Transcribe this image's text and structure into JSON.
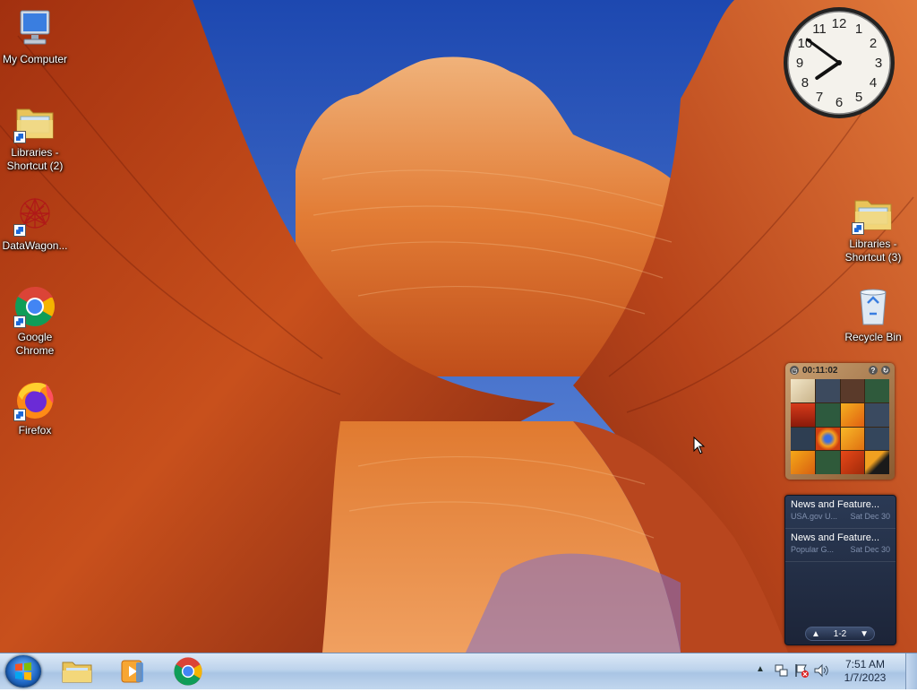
{
  "desktop": {
    "icons_left": [
      {
        "label": "My Computer",
        "icon": "computer-icon"
      },
      {
        "label": "Libraries -\nShortcut (2)",
        "icon": "libraries-icon"
      },
      {
        "label": "DataWagon...",
        "icon": "datawagon-icon"
      },
      {
        "label": "Google\nChrome",
        "icon": "chrome-icon"
      },
      {
        "label": "Firefox",
        "icon": "firefox-icon"
      }
    ],
    "icons_right": [
      {
        "label": "Libraries -\nShortcut (3)",
        "icon": "libraries-icon"
      },
      {
        "label": "Recycle Bin",
        "icon": "recycle-bin-icon"
      }
    ]
  },
  "gadgets": {
    "clock": {
      "hour": 7,
      "minute": 51,
      "numerals": [
        "12",
        "1",
        "2",
        "3",
        "4",
        "5",
        "6",
        "7",
        "8",
        "9",
        "10",
        "11"
      ]
    },
    "puzzle": {
      "timer": "00:11:02",
      "help_glyph": "?",
      "shuffle_glyph": "↻"
    },
    "news": {
      "items": [
        {
          "title": "News and Feature...",
          "source": "USA.gov U...",
          "date": "Sat Dec 30"
        },
        {
          "title": "News and Feature...",
          "source": "Popular G...",
          "date": "Sat Dec 30"
        }
      ],
      "pager": "1-2"
    }
  },
  "taskbar": {
    "pinned": [
      {
        "name": "windows-explorer",
        "icon": "folder-icon"
      },
      {
        "name": "media-player",
        "icon": "media-player-icon"
      },
      {
        "name": "google-chrome",
        "icon": "chrome-icon"
      }
    ],
    "tray": {
      "time": "7:51 AM",
      "date": "1/7/2023",
      "icons": [
        "show-hidden-icon",
        "network-icon",
        "action-center-flag-icon",
        "volume-icon"
      ]
    }
  },
  "colors": {
    "sky": "#2f5fc8",
    "rock_dark": "#8f2a10",
    "rock_light": "#e8893c",
    "taskbar": "#bdd3ec"
  }
}
